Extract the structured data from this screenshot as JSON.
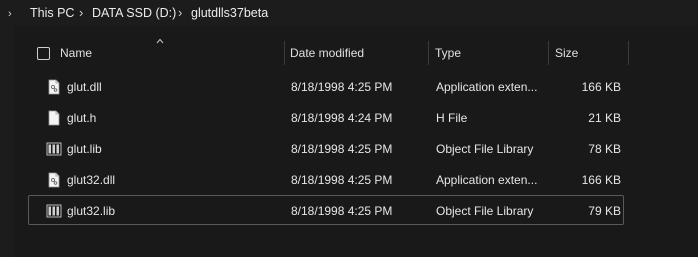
{
  "breadcrumb": {
    "items": [
      "This PC",
      "DATA SSD  (D:)",
      "glutdlls37beta"
    ]
  },
  "header": {
    "name": "Name",
    "date_modified": "Date modified",
    "type": "Type",
    "size": "Size"
  },
  "files": [
    {
      "name": "glut.dll",
      "date": "8/18/1998 4:25 PM",
      "type": "Application exten...",
      "size": "166 KB",
      "icon": "dll-file-icon"
    },
    {
      "name": "glut.h",
      "date": "8/18/1998 4:24 PM",
      "type": "H File",
      "size": "21 KB",
      "icon": "generic-file-icon"
    },
    {
      "name": "glut.lib",
      "date": "8/18/1998 4:25 PM",
      "type": "Object File Library",
      "size": "78 KB",
      "icon": "library-file-icon"
    },
    {
      "name": "glut32.dll",
      "date": "8/18/1998 4:25 PM",
      "type": "Application exten...",
      "size": "166 KB",
      "icon": "dll-file-icon"
    },
    {
      "name": "glut32.lib",
      "date": "8/18/1998 4:25 PM",
      "type": "Object File Library",
      "size": "79 KB",
      "icon": "library-file-icon",
      "selected": true
    }
  ],
  "colors": {
    "background": "#191919",
    "text": "#e6e6e6",
    "divider": "#3b3b3b",
    "selection_border": "#5a5a5a"
  }
}
